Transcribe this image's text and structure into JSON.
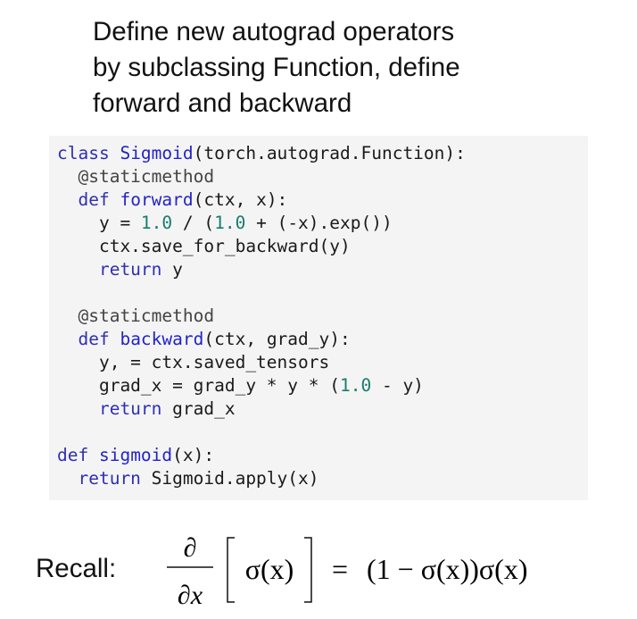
{
  "heading": {
    "lines": [
      "Define new autograd operators",
      "by subclassing Function, define",
      "forward and backward"
    ]
  },
  "code": {
    "lines": [
      [
        {
          "t": "class ",
          "c": "kw"
        },
        {
          "t": "Sigmoid",
          "c": "fn"
        },
        {
          "t": "(torch.autograd.Function):",
          "c": "txt"
        }
      ],
      [
        {
          "t": "  @staticmethod",
          "c": "dec"
        }
      ],
      [
        {
          "t": "  def ",
          "c": "kw"
        },
        {
          "t": "forward",
          "c": "fn"
        },
        {
          "t": "(ctx, x):",
          "c": "txt"
        }
      ],
      [
        {
          "t": "    y = ",
          "c": "txt"
        },
        {
          "t": "1.0",
          "c": "num"
        },
        {
          "t": " / (",
          "c": "txt"
        },
        {
          "t": "1.0",
          "c": "num"
        },
        {
          "t": " + (-x).exp())",
          "c": "txt"
        }
      ],
      [
        {
          "t": "    ctx.save_for_backward(y)",
          "c": "txt"
        }
      ],
      [
        {
          "t": "    return",
          "c": "kw"
        },
        {
          "t": " y",
          "c": "txt"
        }
      ],
      [],
      [
        {
          "t": "  @staticmethod",
          "c": "dec"
        }
      ],
      [
        {
          "t": "  def ",
          "c": "kw"
        },
        {
          "t": "backward",
          "c": "fn"
        },
        {
          "t": "(ctx, grad_y):",
          "c": "txt"
        }
      ],
      [
        {
          "t": "    y, = ctx.saved_tensors",
          "c": "txt"
        }
      ],
      [
        {
          "t": "    grad_x = grad_y * y * (",
          "c": "txt"
        },
        {
          "t": "1.0",
          "c": "num"
        },
        {
          "t": " - y)",
          "c": "txt"
        }
      ],
      [
        {
          "t": "    return",
          "c": "kw"
        },
        {
          "t": " grad_x",
          "c": "txt"
        }
      ],
      [],
      [
        {
          "t": "def ",
          "c": "kw"
        },
        {
          "t": "sigmoid",
          "c": "fn"
        },
        {
          "t": "(x):",
          "c": "txt"
        }
      ],
      [
        {
          "t": "  return",
          "c": "kw"
        },
        {
          "t": " Sigmoid.apply(x)",
          "c": "txt"
        }
      ]
    ]
  },
  "recall": {
    "label": "Recall:",
    "formula": {
      "numerator": "∂",
      "denominator": "∂x",
      "lhs_inner": "σ(x)",
      "equals": "=",
      "rhs": "(1 − σ(x))σ(x)"
    }
  },
  "colors": {
    "keyword": "#2f2fb4",
    "function_name": "#2323c8",
    "number": "#177d6a",
    "code_background": "#f4f4f4"
  }
}
